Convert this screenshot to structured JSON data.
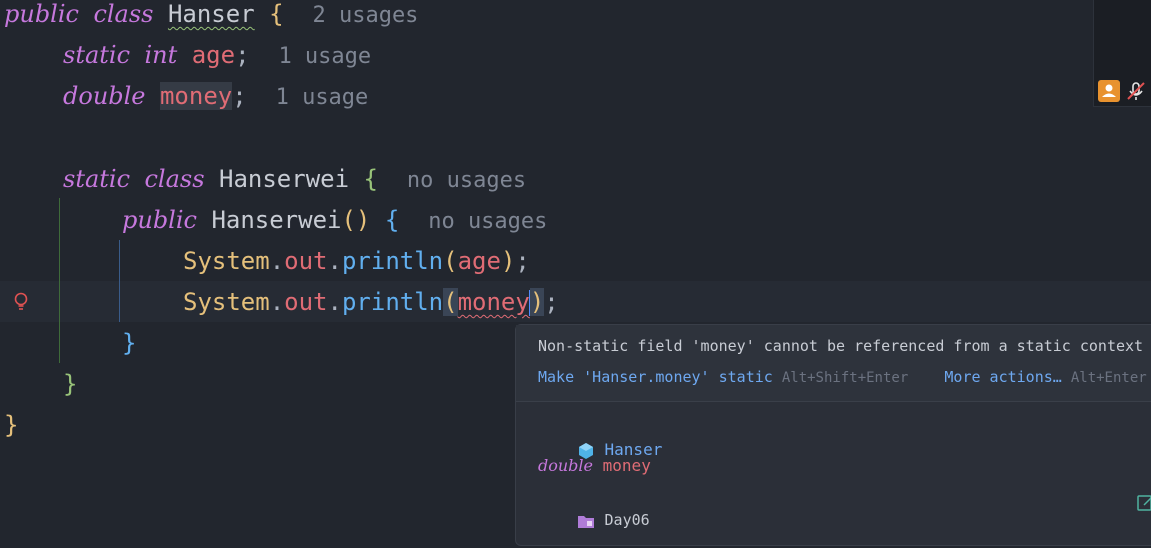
{
  "editor": {
    "lines": {
      "l1": {
        "kw1": "public",
        "kw2": "class",
        "name": "Hanser",
        "brace": "{",
        "hint": "2 usages"
      },
      "l2": {
        "kw1": "static",
        "kw2": "int",
        "field": "age",
        "semi": ";",
        "hint": "1 usage"
      },
      "l3": {
        "kw1": "double",
        "field": "money",
        "semi": ";",
        "hint": "1 usage"
      },
      "l5": {
        "kw1": "static",
        "kw2": "class",
        "name": "Hanserwei",
        "brace": "{",
        "hint": "no usages"
      },
      "l6": {
        "kw1": "public",
        "name": "Hanserwei",
        "parens": "()",
        "brace": "{",
        "hint": "no usages"
      },
      "l7": {
        "sys": "System",
        "dot1": ".",
        "out": "out",
        "dot2": ".",
        "fn": "println",
        "open": "(",
        "arg": "age",
        "close": ")",
        "semi": ";"
      },
      "l8": {
        "sys": "System",
        "dot1": ".",
        "out": "out",
        "dot2": ".",
        "fn": "println",
        "open": "(",
        "arg": "money",
        "close": ")",
        "semi": ";"
      },
      "l9": {
        "brace": "}"
      },
      "l10": {
        "brace": "}"
      },
      "l11": {
        "brace": "}"
      }
    }
  },
  "popup": {
    "message": "Non-static field 'money' cannot be referenced from a static context",
    "fix_action": "Make 'Hanser.money' static",
    "fix_shortcut": "Alt+Shift+Enter",
    "more_action": "More actions…",
    "more_shortcut": "Alt+Enter",
    "class_name": "Hanser",
    "decl_type": "double",
    "decl_field": "money",
    "package": "Day06"
  },
  "colors": {
    "background": "#22262e",
    "keyword": "#c678dd",
    "field": "#e06c75",
    "link": "#6ea8f0"
  },
  "icons": {
    "gutter": "lightbulb-icon",
    "class": "class-cube-icon",
    "package": "package-folder-icon",
    "edit": "edit-source-icon",
    "user": "user-icon",
    "mute": "muted-icon"
  }
}
